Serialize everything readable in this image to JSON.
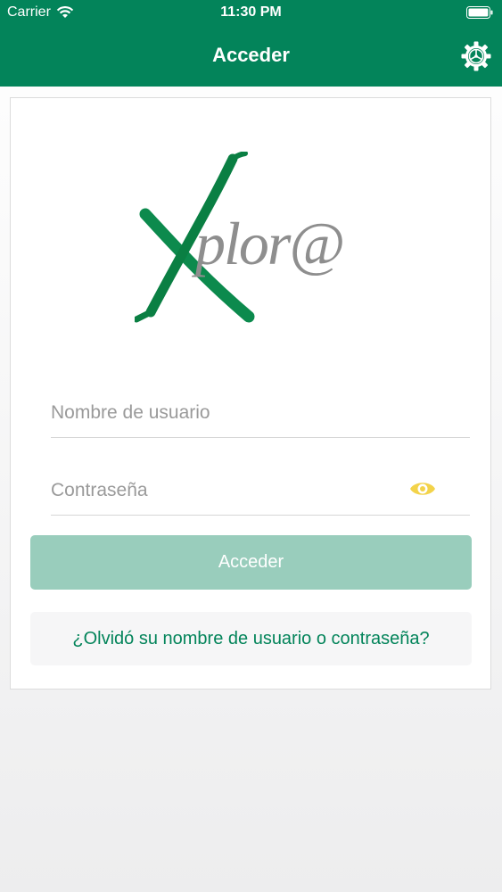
{
  "status_bar": {
    "carrier": "Carrier",
    "time": "11:30 PM"
  },
  "nav": {
    "title": "Acceder",
    "settings_icon": "gear-icon"
  },
  "logo": {
    "brand_x": "X",
    "brand_rest": "plor@"
  },
  "form": {
    "username_placeholder": "Nombre de usuario",
    "password_placeholder": "Contraseña",
    "login_label": "Acceder",
    "forgot_label": "¿Olvidó su nombre de usuario o contraseña?"
  },
  "colors": {
    "primary": "#03845a",
    "button_disabled": "#99cdbc",
    "eye_icon": "#f3d34a"
  }
}
